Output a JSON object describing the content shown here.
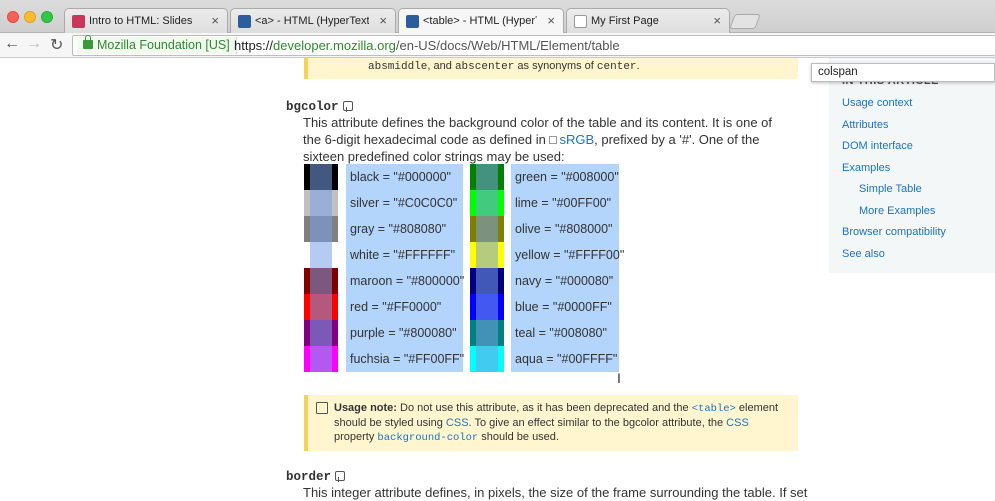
{
  "tabs": [
    {
      "label": "Intro to HTML: Slides",
      "icon": "slides-favicon-icon"
    },
    {
      "label": "<a> - HTML (HyperText Ma",
      "icon": "mdn-favicon-icon"
    },
    {
      "label": "<table> - HTML (HyperText",
      "icon": "mdn-favicon-icon"
    },
    {
      "label": "My First Page",
      "icon": "page-icon"
    }
  ],
  "toolbar": {
    "ev_label": "Mozilla Foundation [US]",
    "url_scheme": "https://",
    "url_host": "developer.mozilla.org",
    "url_path": "/en-US/docs/Web/HTML/Element/table"
  },
  "find_query": "colspan",
  "top_note": {
    "code1": "absmiddle",
    "mid": ", and ",
    "code2": "abscenter",
    "mid2": " as synonyms of ",
    "code3": "center",
    "end": "."
  },
  "bgcolor": {
    "heading": "bgcolor",
    "desc_part1": "This attribute defines the background color of the table and its content. It is one of the 6-digit hexadecimal code as defined in ",
    "desc_link": "sRGB",
    "desc_part2": ", prefixed by a '#'. One of the sixteen predefined color strings may be used:"
  },
  "colors_left": [
    {
      "label": "black = \"#000000\"",
      "color": "#000000"
    },
    {
      "label": "silver = \"#C0C0C0\"",
      "color": "#C0C0C0"
    },
    {
      "label": "gray = \"#808080\"",
      "color": "#808080"
    },
    {
      "label": "white = \"#FFFFFF\"",
      "color": "#FFFFFF"
    },
    {
      "label": "maroon = \"#800000\"",
      "color": "#800000"
    },
    {
      "label": "red = \"#FF0000\"",
      "color": "#FF0000"
    },
    {
      "label": "purple = \"#800080\"",
      "color": "#800080"
    },
    {
      "label": "fuchsia = \"#FF00FF\"",
      "color": "#FF00FF"
    }
  ],
  "colors_right": [
    {
      "label": "green = \"#008000\"",
      "color": "#008000"
    },
    {
      "label": "lime = \"#00FF00\"",
      "color": "#00FF00"
    },
    {
      "label": "olive = \"#808000\"",
      "color": "#808000"
    },
    {
      "label": "yellow = \"#FFFF00\"",
      "color": "#FFFF00"
    },
    {
      "label": "navy = \"#000080\"",
      "color": "#000080"
    },
    {
      "label": "blue = \"#0000FF\"",
      "color": "#0000FF"
    },
    {
      "label": "teal = \"#008080\"",
      "color": "#008080"
    },
    {
      "label": "aqua = \"#00FFFF\"",
      "color": "#00FFFF"
    }
  ],
  "usage_note": {
    "label": "Usage note:",
    "t1": " Do not use this attribute, as it has been deprecated and the ",
    "code1": "<table>",
    "t2": " element should be styled using ",
    "link1": "CSS",
    "t3": ". To give an effect similar to the bgcolor attribute, the ",
    "link2": "CSS",
    "t4": " property ",
    "code2": "background-color",
    "t5": " should be used."
  },
  "border": {
    "heading": "border",
    "desc": "This integer attribute defines, in pixels, the size of the frame surrounding the table. If set"
  },
  "sidebar": {
    "heading": "IN THIS ARTICLE",
    "items": [
      "Usage context",
      "Attributes",
      "DOM interface",
      "Examples",
      "Simple Table",
      "More Examples",
      "Browser compatibility",
      "See also"
    ]
  }
}
